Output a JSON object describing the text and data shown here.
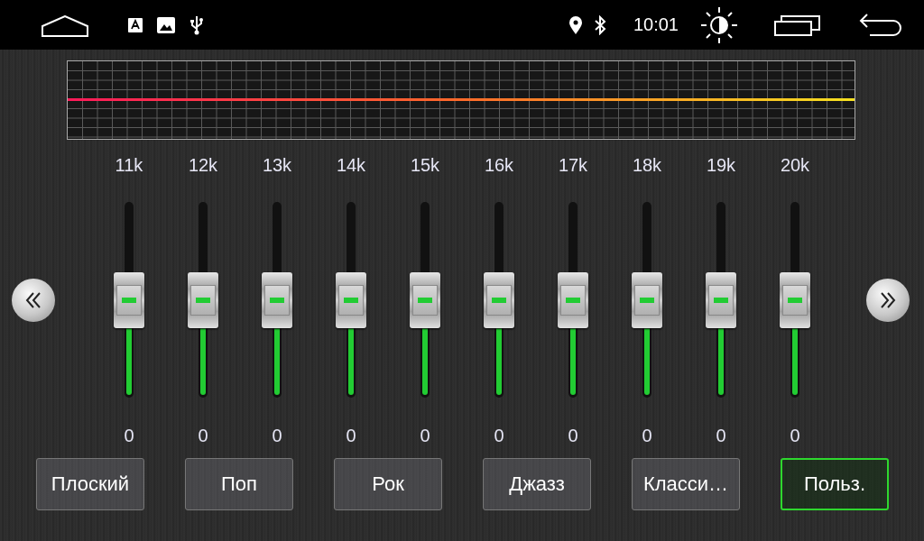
{
  "status_bar": {
    "time": "10:01"
  },
  "bands": [
    {
      "label": "11k",
      "level": 0.5,
      "value": "0"
    },
    {
      "label": "12k",
      "level": 0.5,
      "value": "0"
    },
    {
      "label": "13k",
      "level": 0.5,
      "value": "0"
    },
    {
      "label": "14k",
      "level": 0.5,
      "value": "0"
    },
    {
      "label": "15k",
      "level": 0.5,
      "value": "0"
    },
    {
      "label": "16k",
      "level": 0.5,
      "value": "0"
    },
    {
      "label": "17k",
      "level": 0.5,
      "value": "0"
    },
    {
      "label": "18k",
      "level": 0.5,
      "value": "0"
    },
    {
      "label": "19k",
      "level": 0.5,
      "value": "0"
    },
    {
      "label": "20k",
      "level": 0.5,
      "value": "0"
    }
  ],
  "presets": [
    {
      "label": "Плоский",
      "selected": false
    },
    {
      "label": "Поп",
      "selected": false
    },
    {
      "label": "Рок",
      "selected": false
    },
    {
      "label": "Джазз",
      "selected": false
    },
    {
      "label": "Класси…",
      "selected": false
    },
    {
      "label": "Польз.",
      "selected": true
    }
  ]
}
